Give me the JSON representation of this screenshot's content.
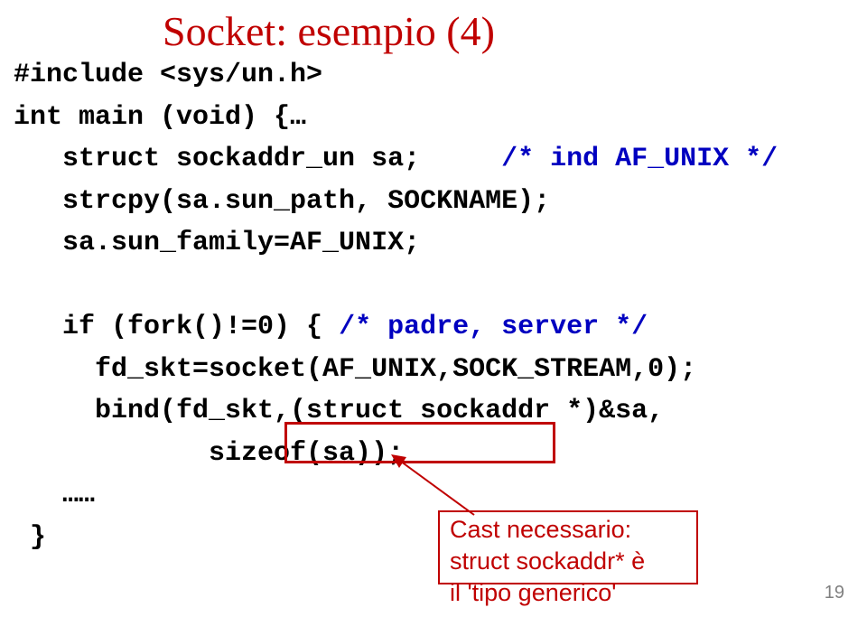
{
  "title": "Socket: esempio (4)",
  "code": {
    "l1": "#include <sys/un.h>",
    "l2": "int main (void) {…",
    "l3a": "   struct sockaddr_un sa;     ",
    "l3b": "/* ind AF_UNIX */",
    "l4": "   strcpy(sa.sun_path, SOCKNAME);",
    "l5": "   sa.sun_family=AF_UNIX;",
    "l6a": "   if (fork()!=0) { ",
    "l6b": "/* padre, server */",
    "l7": "     fd_skt=socket(AF_UNIX,SOCK_STREAM,0);",
    "l8": "     bind(fd_skt,(struct sockaddr *)&sa,",
    "l9": "            sizeof(sa));",
    "l10": "   ……",
    "l11": " }"
  },
  "callout": {
    "line1": "Cast necessario:",
    "line2_a": "struct sockaddr* ",
    "line2_b": "è",
    "line3": "il 'tipo generico'"
  },
  "pageNumber": "19"
}
